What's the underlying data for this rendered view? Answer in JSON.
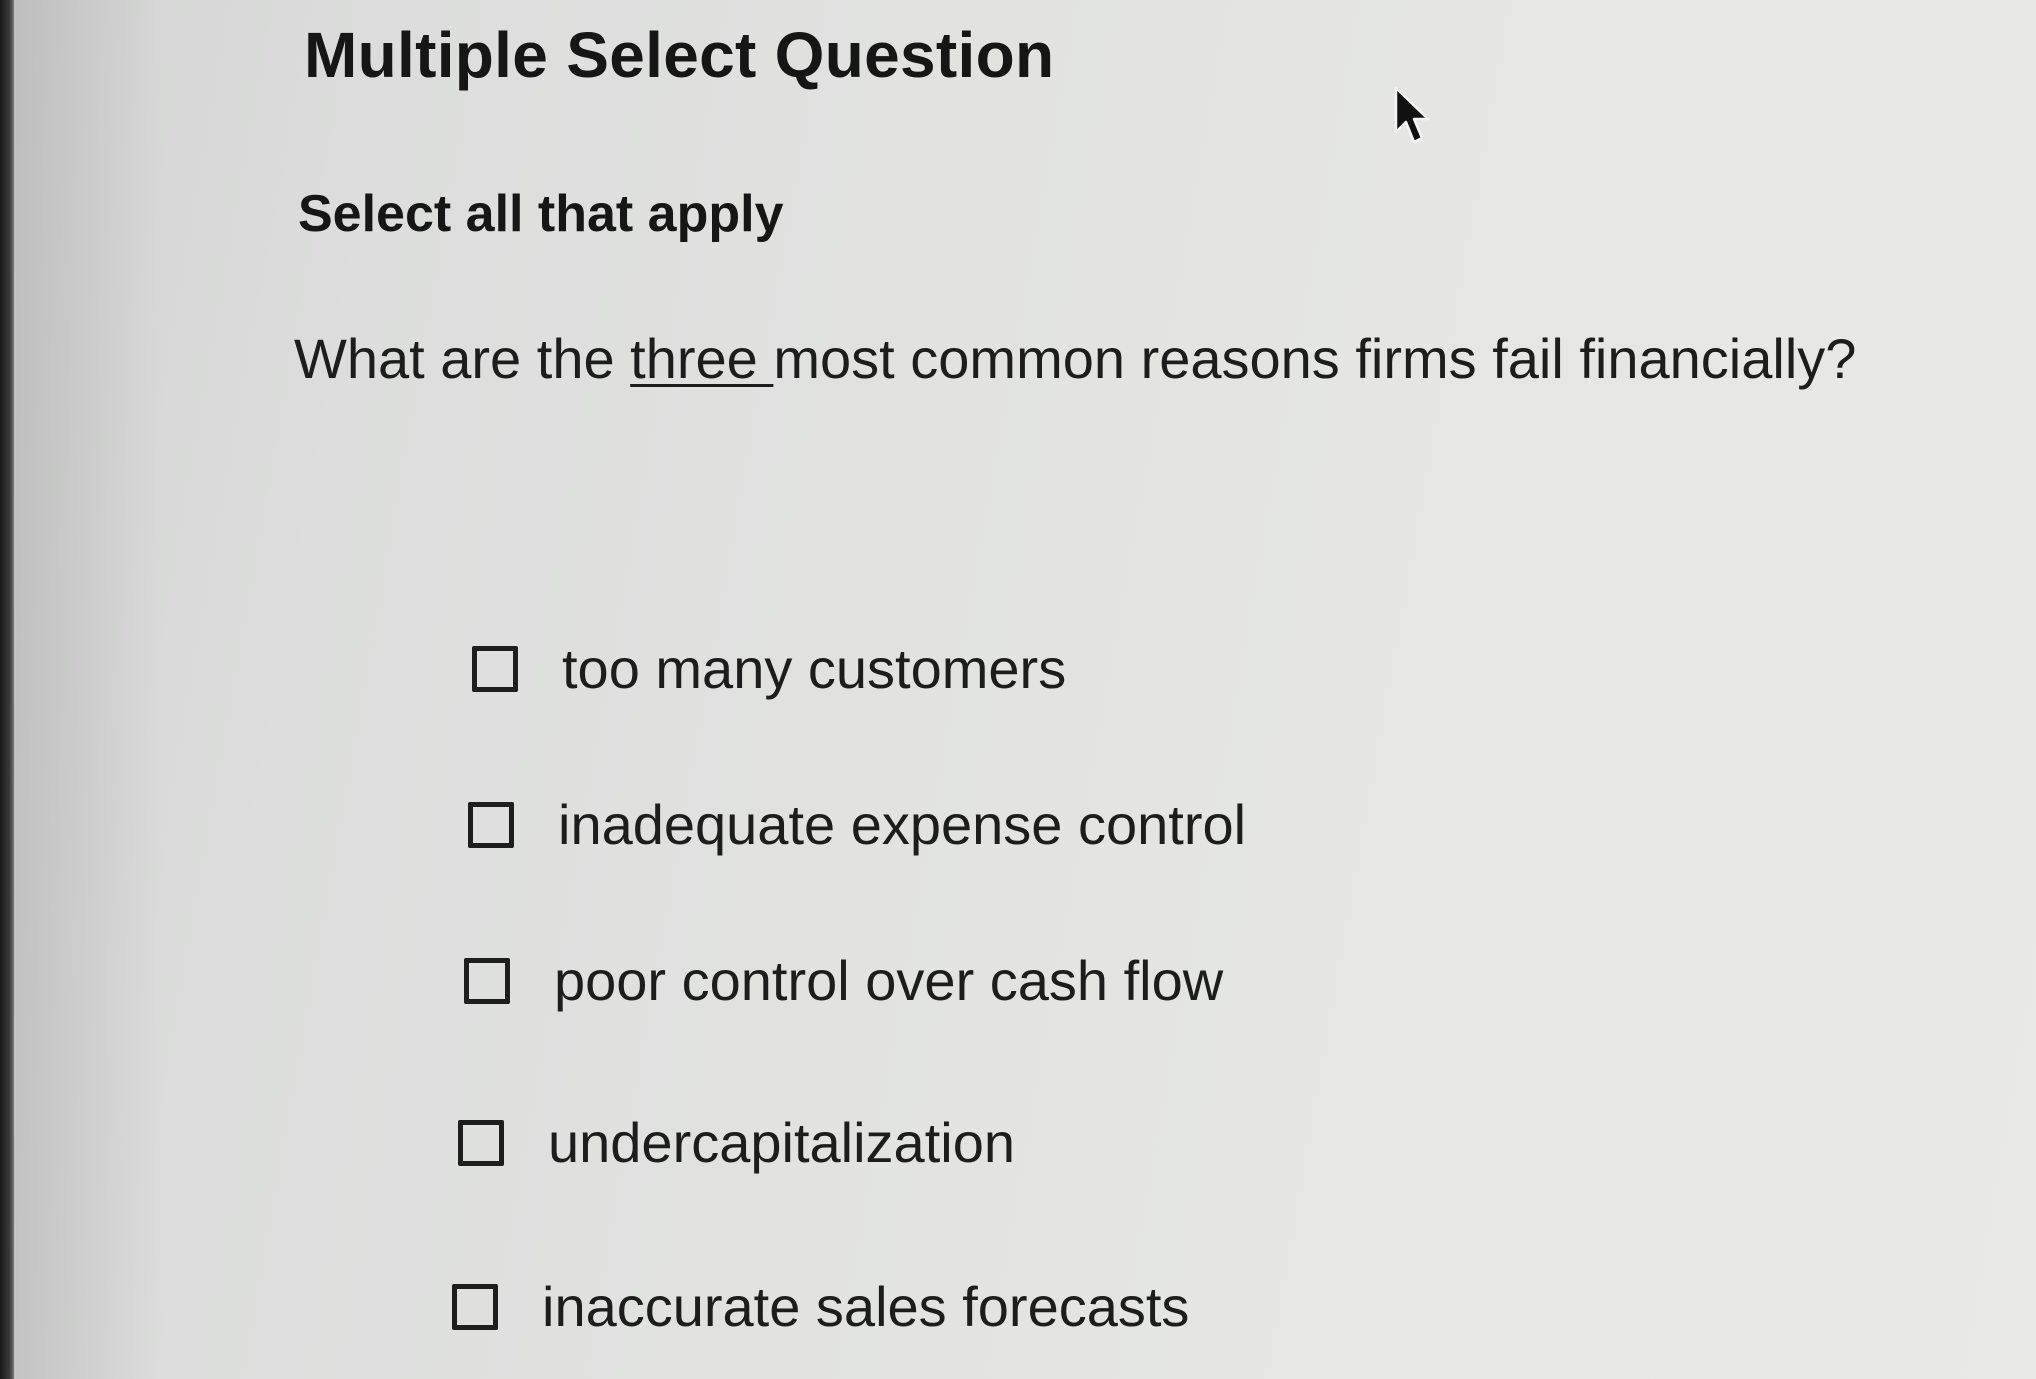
{
  "question": {
    "heading": "Multiple Select Question",
    "instruction": "Select all that apply",
    "prompt_before": "What are the ",
    "prompt_emphasis": "three ",
    "prompt_after": "most common reasons firms fail financially?"
  },
  "options": [
    {
      "label": "too many customers",
      "checked": false
    },
    {
      "label": "inadequate expense control",
      "checked": false
    },
    {
      "label": "poor control over cash flow",
      "checked": false
    },
    {
      "label": "undercapitalization",
      "checked": false
    },
    {
      "label": "inaccurate sales forecasts",
      "checked": false
    }
  ],
  "icons": {
    "cursor": "mouse-pointer-icon",
    "checkbox": "checkbox-unchecked-icon"
  },
  "colors": {
    "text": "#1b1b1b",
    "background": "#e3e4e2"
  }
}
